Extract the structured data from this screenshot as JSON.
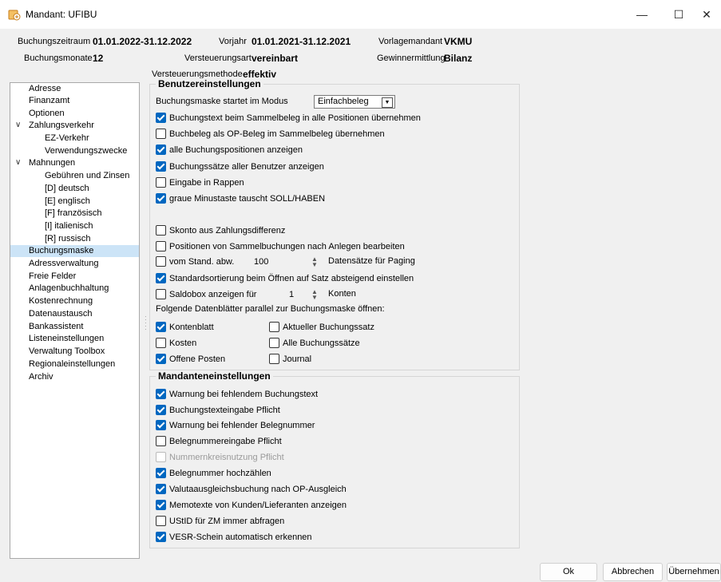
{
  "window": {
    "title": "Mandant: UFIBU",
    "minimize": "—",
    "maximize": "☐",
    "close": "✕"
  },
  "header": {
    "buchungszeitraum_label": "Buchungszeitraum",
    "buchungszeitraum_value": "01.01.2022-31.12.2022",
    "vorjahr_label": "Vorjahr",
    "vorjahr_value": "01.01.2021-31.12.2021",
    "vorlagemandant_label": "Vorlagemandant",
    "vorlagemandant_value": "VKMU",
    "buchungsmonate_label": "Buchungsmonate",
    "buchungsmonate_value": "12",
    "versteuerungsart_label": "Versteuerungsart",
    "versteuerungsart_value": "vereinbart",
    "gewinnermittlung_label": "Gewinnermittlung",
    "gewinnermittlung_value": "Bilanz",
    "versteuerungsmethode_label": "Versteuerungsmethode",
    "versteuerungsmethode_value": "effektiv"
  },
  "nav": {
    "items": [
      {
        "label": "Adresse"
      },
      {
        "label": "Finanzamt"
      },
      {
        "label": "Optionen"
      },
      {
        "label": "Zahlungsverkehr",
        "expander": "∨"
      },
      {
        "label": "EZ-Verkehr"
      },
      {
        "label": "Verwendungszwecke"
      },
      {
        "label": "Mahnungen",
        "expander": "∨"
      },
      {
        "label": "Gebühren und Zinsen"
      },
      {
        "label": "[D]  deutsch"
      },
      {
        "label": "[E]  englisch"
      },
      {
        "label": "[F]  französisch"
      },
      {
        "label": "[I]  italienisch"
      },
      {
        "label": "[R]  russisch"
      },
      {
        "label": "Buchungsmaske"
      },
      {
        "label": "Adressverwaltung"
      },
      {
        "label": "Freie Felder"
      },
      {
        "label": "Anlagenbuchhaltung"
      },
      {
        "label": "Kostenrechnung"
      },
      {
        "label": "Datenaustausch"
      },
      {
        "label": "Bankassistent"
      },
      {
        "label": "Listeneinstellungen"
      },
      {
        "label": "Verwaltung Toolbox"
      },
      {
        "label": "Regionaleinstellungen"
      },
      {
        "label": "Archiv"
      }
    ]
  },
  "benutzer": {
    "title": "Benutzereinstellungen",
    "modus_label": "Buchungsmaske startet im Modus",
    "modus_value": "Einfachbeleg",
    "checks": [
      {
        "label": "Buchungstext beim Sammelbeleg in alle Positionen übernehmen",
        "checked": true
      },
      {
        "label": "Buchbeleg als OP-Beleg im Sammelbeleg übernehmen",
        "checked": false
      },
      {
        "label": "alle Buchungspositionen anzeigen",
        "checked": true
      },
      {
        "label": "Buchungssätze aller Benutzer anzeigen",
        "checked": true
      },
      {
        "label": "Eingabe in Rappen",
        "checked": false
      },
      {
        "label": "graue Minustaste tauscht SOLL/HABEN",
        "checked": true
      },
      {
        "label": "Skonto aus Zahlungsdifferenz",
        "checked": false
      },
      {
        "label": "Positionen von Sammelbuchungen nach Anlegen bearbeiten",
        "checked": false
      }
    ],
    "vom_stand_label": "vom Stand. abw.",
    "vom_stand_value": "100",
    "datensaetze_label": "Datensätze für Paging",
    "standardsortierung_label": "Standardsortierung beim Öffnen auf Satz absteigend einstellen",
    "saldobox_label": "Saldobox anzeigen für",
    "saldobox_value": "1",
    "konten_label": "Konten",
    "datenblaetter_label": "Folgende Datenblätter parallel zur Buchungsmaske öffnen:",
    "blatt": [
      {
        "label": "Kontenblatt",
        "checked": true
      },
      {
        "label": "Aktueller Buchungssatz",
        "checked": false
      },
      {
        "label": "Kosten",
        "checked": false
      },
      {
        "label": "Alle Buchungssätze",
        "checked": false
      },
      {
        "label": "Offene Posten",
        "checked": true
      },
      {
        "label": "Journal",
        "checked": false
      }
    ]
  },
  "mandant": {
    "title": "Mandanteneinstellungen",
    "checks": [
      {
        "label": "Warnung bei fehlendem Buchungstext",
        "checked": true
      },
      {
        "label": "Buchungstexteingabe Pflicht",
        "checked": true
      },
      {
        "label": "Warnung bei fehlender Belegnummer",
        "checked": true
      },
      {
        "label": "Belegnummereingabe Pflicht",
        "checked": false
      },
      {
        "label": "Nummernkreisnutzung Pflicht",
        "checked": false,
        "disabled": true
      },
      {
        "label": "Belegnummer hochzählen",
        "checked": true
      },
      {
        "label": "Valutaausgleichsbuchung nach OP-Ausgleich",
        "checked": true
      },
      {
        "label": "Memotexte von Kunden/Lieferanten anzeigen",
        "checked": true
      },
      {
        "label": "UStID für ZM immer abfragen",
        "checked": false
      },
      {
        "label": "VESR-Schein automatisch erkennen",
        "checked": true
      }
    ]
  },
  "buttons": {
    "ok": "Ok",
    "abbrechen": "Abbrechen",
    "uebernehmen": "Übernehmen"
  }
}
